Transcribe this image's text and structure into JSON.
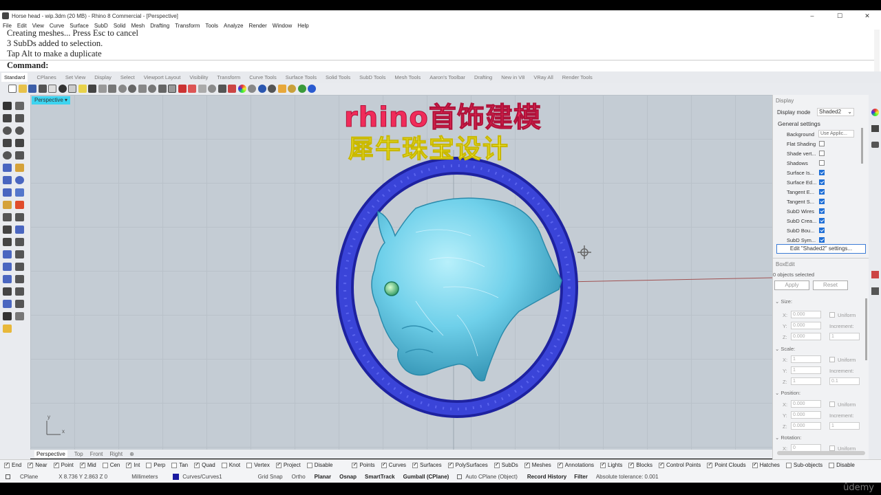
{
  "window": {
    "title": "Horse head - wip.3dm (20 MB) - Rhino 8 Commercial - [Perspective]",
    "controls": [
      "–",
      "☐",
      "✕"
    ]
  },
  "menu": [
    "File",
    "Edit",
    "View",
    "Curve",
    "Surface",
    "SubD",
    "Solid",
    "Mesh",
    "Drafting",
    "Transform",
    "Tools",
    "Analyze",
    "Render",
    "Window",
    "Help"
  ],
  "command_history": {
    "line1": "Creating meshes... Press Esc to cancel",
    "line2": "3 SubDs added to selection.",
    "line3": "Tap Alt to make a duplicate",
    "prompt": "Command:"
  },
  "toolbar_tabs": [
    "Standard",
    "CPlanes",
    "Set View",
    "Display",
    "Select",
    "Viewport Layout",
    "Visibility",
    "Transform",
    "Curve Tools",
    "Surface Tools",
    "Solid Tools",
    "SubD Tools",
    "Mesh Tools",
    "Aaron's Toolbar",
    "Drafting",
    "New in V8",
    "VRay All",
    "Render Tools"
  ],
  "viewport": {
    "name": "Perspective",
    "watermark_line1": "rhino首饰建模",
    "watermark_line2": "犀牛珠宝设计",
    "axis_y": "y",
    "axis_x": "x"
  },
  "viewport_tabs": [
    "Perspective",
    "Top",
    "Front",
    "Right",
    "⊕"
  ],
  "display_panel": {
    "header": "Display",
    "mode_label": "Display mode",
    "mode_value": "Shaded2",
    "general_settings": "General settings",
    "rows": [
      {
        "label": "Background",
        "value": "Use Applic..."
      },
      {
        "label": "Flat Shading",
        "checked": false
      },
      {
        "label": "Shade vert...",
        "checked": false
      },
      {
        "label": "Shadows",
        "checked": false
      },
      {
        "label": "Surface Is...",
        "checked": true
      },
      {
        "label": "Surface Ed...",
        "checked": true
      },
      {
        "label": "Tangent E...",
        "checked": true
      },
      {
        "label": "Tangent S...",
        "checked": true
      },
      {
        "label": "SubD Wires",
        "checked": true
      },
      {
        "label": "SubD Crea...",
        "checked": true
      },
      {
        "label": "SubD Bou...",
        "checked": true
      },
      {
        "label": "SubD Sym...",
        "checked": true
      }
    ],
    "edit_button": "Edit \"Shaded2\" settings..."
  },
  "boxedit_panel": {
    "header": "BoxEdit",
    "selected": "0 objects selected",
    "apply": "Apply",
    "reset": "Reset",
    "sections": [
      {
        "title": "Size:",
        "x": "0.000",
        "y": "0.000",
        "z": "0.000",
        "uniform": "Uniform",
        "increment_label": "Increment:",
        "increment": "1"
      },
      {
        "title": "Scale:",
        "x": "1",
        "y": "1",
        "z": "1",
        "uniform": "Uniform",
        "increment_label": "Increment:",
        "increment": "0.1"
      },
      {
        "title": "Position:",
        "x": "0.000",
        "y": "0.000",
        "z": "0.000",
        "uniform": "Uniform",
        "increment_label": "Increment:",
        "increment": "1"
      },
      {
        "title": "Rotation:",
        "x": "0",
        "uniform": "Uniform"
      }
    ]
  },
  "osnaps": [
    {
      "label": "End",
      "checked": true
    },
    {
      "label": "Near",
      "checked": true
    },
    {
      "label": "Point",
      "checked": true
    },
    {
      "label": "Mid",
      "checked": true
    },
    {
      "label": "Cen",
      "checked": false
    },
    {
      "label": "Int",
      "checked": true
    },
    {
      "label": "Perp",
      "checked": false
    },
    {
      "label": "Tan",
      "checked": false
    },
    {
      "label": "Quad",
      "checked": true
    },
    {
      "label": "Knot",
      "checked": false
    },
    {
      "label": "Vertex",
      "checked": false
    },
    {
      "label": "Project",
      "checked": true
    },
    {
      "label": "Disable",
      "checked": false
    }
  ],
  "selection_filters": [
    {
      "label": "Points",
      "checked": true
    },
    {
      "label": "Curves",
      "checked": true
    },
    {
      "label": "Surfaces",
      "checked": true
    },
    {
      "label": "PolySurfaces",
      "checked": true
    },
    {
      "label": "SubDs",
      "checked": true
    },
    {
      "label": "Meshes",
      "checked": true
    },
    {
      "label": "Annotations",
      "checked": true
    },
    {
      "label": "Lights",
      "checked": true
    },
    {
      "label": "Blocks",
      "checked": true
    },
    {
      "label": "Control Points",
      "checked": true
    },
    {
      "label": "Point Clouds",
      "checked": true
    },
    {
      "label": "Hatches",
      "checked": true
    },
    {
      "label": "Sub-objects",
      "checked": false
    },
    {
      "label": "Disable",
      "checked": false
    }
  ],
  "status": {
    "cplane": "CPlane",
    "coords": "X 8.736 Y 2.863 Z 0",
    "units": "Millimeters",
    "layer": "Curves/Curves1",
    "layer_color": "#1a1aa0",
    "grid_snap": "Grid Snap",
    "ortho": "Ortho",
    "planar": "Planar",
    "osnap": "Osnap",
    "smarttrack": "SmartTrack",
    "gumball": "Gumball (CPlane)",
    "auto_cplane": "Auto CPlane (Object)",
    "record_history": "Record History",
    "filter": "Filter",
    "tolerance": "Absolute tolerance: 0.001"
  },
  "udemy": "ûdemy",
  "colors": {
    "ring": "#2f35c8",
    "horse": "#6fd0ea",
    "viewport_tab": "#3dd4f0",
    "watermark_red": "#f02c5a",
    "watermark_yellow": "#f8f24a"
  }
}
